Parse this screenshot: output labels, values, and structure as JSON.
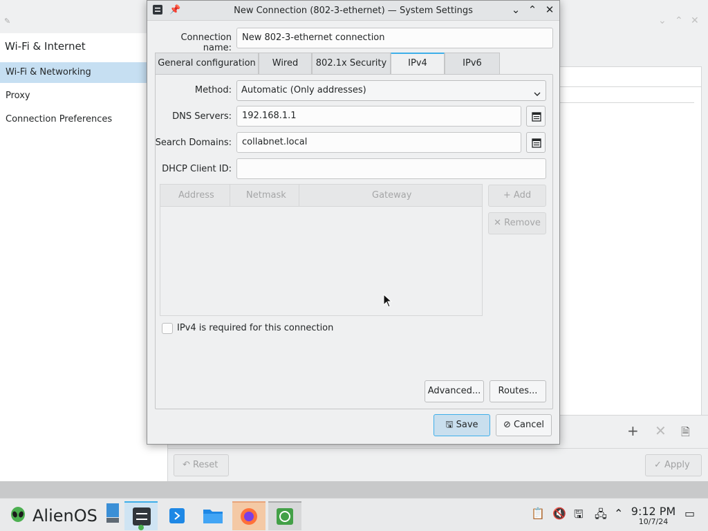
{
  "background": {
    "sidebar_heading": "Wi-Fi & Internet",
    "sidebar_items": [
      "Wi-Fi & Networking",
      "Proxy",
      "Connection Preferences"
    ],
    "reset_label": "Reset",
    "apply_label": "Apply"
  },
  "dialog": {
    "title": "New Connection (802-3-ethernet) — System Settings",
    "connection_name_label": "Connection name:",
    "connection_name_value": "New 802-3-ethernet connection",
    "tabs": [
      "General configuration",
      "Wired",
      "802.1x Security",
      "IPv4",
      "IPv6"
    ],
    "active_tab": "IPv4",
    "method_label": "Method:",
    "method_value": "Automatic (Only addresses)",
    "dns_label": "DNS Servers:",
    "dns_value": "192.168.1.1",
    "search_domains_label": "Search Domains:",
    "search_domains_value": "collabnet.local",
    "dhcp_client_id_label": "DHCP Client ID:",
    "dhcp_client_id_value": "",
    "table_headers": [
      "Address",
      "Netmask",
      "Gateway"
    ],
    "add_label": "Add",
    "remove_label": "Remove",
    "ipv4_required_label": "IPv4 is required for this connection",
    "ipv4_required_checked": false,
    "advanced_label": "Advanced...",
    "routes_label": "Routes...",
    "save_label": "Save",
    "cancel_label": "Cancel"
  },
  "taskbar": {
    "os_name": "AlienOS",
    "clock_time": "9:12 PM",
    "clock_date": "10/7/24"
  },
  "colors": {
    "accent": "#3daee9",
    "selection": "#c6dff2"
  }
}
